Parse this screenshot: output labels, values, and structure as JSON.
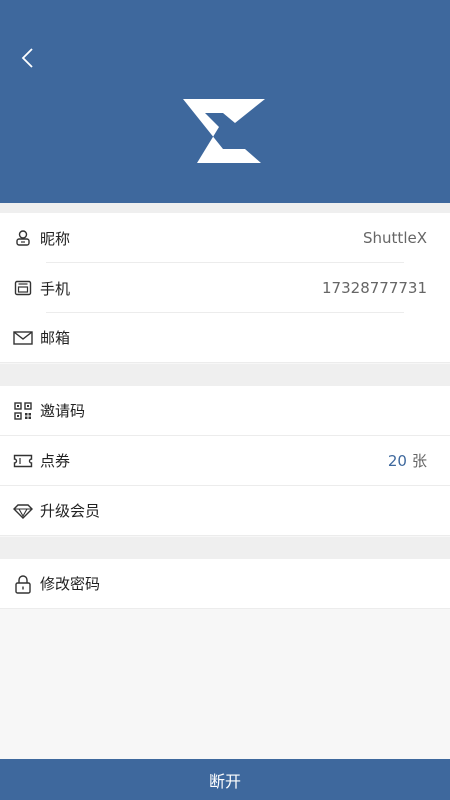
{
  "header": {
    "back_icon": "chevron-left-icon",
    "logo_icon": "shuttlex-z-logo-icon",
    "background_color": "#3e689d"
  },
  "profile": {
    "nickname": {
      "label": "昵称",
      "value": "ShuttleX",
      "icon": "user-icon"
    },
    "phone": {
      "label": "手机",
      "value": "17328777731",
      "icon": "sim-card-icon"
    },
    "email": {
      "label": "邮箱",
      "value": "",
      "icon": "envelope-icon"
    }
  },
  "account": {
    "invite": {
      "label": "邀请码",
      "icon": "qr-code-icon"
    },
    "coupons": {
      "label": "点券",
      "count": "20",
      "unit": "张",
      "icon": "ticket-icon"
    },
    "upgrade": {
      "label": "升级会员",
      "icon": "diamond-icon"
    }
  },
  "security": {
    "password": {
      "label": "修改密码",
      "icon": "lock-icon"
    }
  },
  "footer": {
    "disconnect_label": "断开"
  }
}
